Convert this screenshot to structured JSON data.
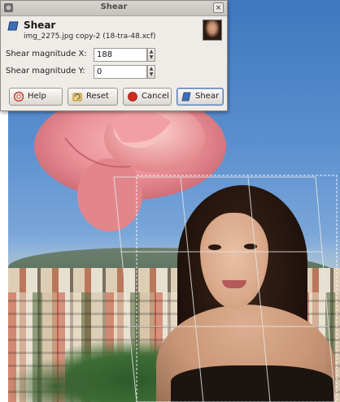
{
  "dialog": {
    "window_title": "Shear",
    "close_glyph": "×",
    "heading": "Shear",
    "subtitle": "img_2275.jpg copy-2 (18-tra-48.xcf)",
    "fields": [
      {
        "label": "Shear magnitude X:",
        "value": "188"
      },
      {
        "label": "Shear magnitude Y:",
        "value": "0"
      }
    ],
    "buttons": {
      "help": "Help",
      "reset": "Reset",
      "cancel": "Cancel",
      "shear": "Shear"
    }
  },
  "icons": {
    "app": "gimp-icon",
    "tool": "shear-tool-icon",
    "thumbnail": "image-thumbnail",
    "help": "help-icon",
    "reset": "reset-icon",
    "cancel": "cancel-icon",
    "shear": "shear-icon"
  },
  "colors": {
    "dialog_bg": "#efebe7",
    "cancel_red": "#d42a1f",
    "shear_blue": "#3d6eb5"
  }
}
